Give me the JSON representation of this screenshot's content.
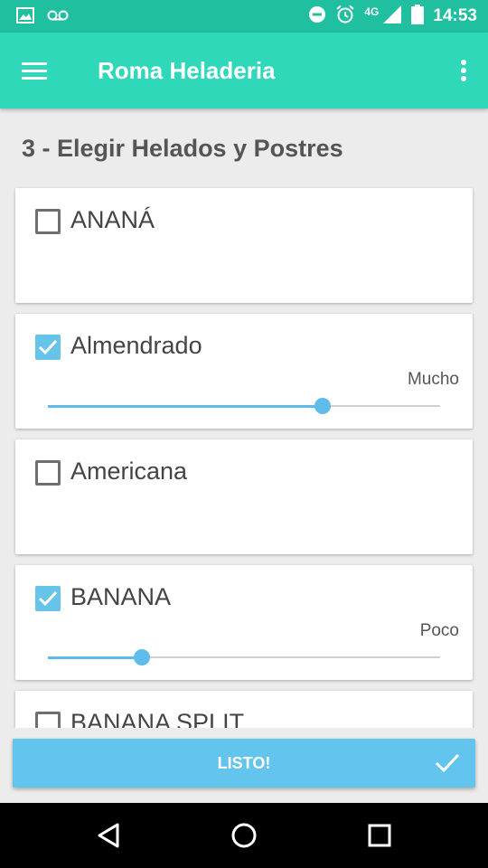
{
  "status_bar": {
    "time": "14:53",
    "network": "4G",
    "icons_left": [
      "image-icon",
      "voicemail-icon"
    ],
    "icons_right": [
      "do-not-disturb-icon",
      "alarm-icon",
      "signal-icon",
      "battery-icon"
    ]
  },
  "app_bar": {
    "title": "Roma Heladeria",
    "menu_icon": "hamburger-menu-icon",
    "overflow_icon": "more-vert-icon"
  },
  "section_title": "3 - Elegir Helados y Postres",
  "items": [
    {
      "name": "ANANÁ",
      "checked": false,
      "quantity_label": "",
      "slider_fraction": null
    },
    {
      "name": "Almendrado",
      "checked": true,
      "quantity_label": "Mucho",
      "slider_fraction": 0.7
    },
    {
      "name": "Americana",
      "checked": false,
      "quantity_label": "",
      "slider_fraction": null
    },
    {
      "name": "BANANA",
      "checked": true,
      "quantity_label": "Poco",
      "slider_fraction": 0.24
    },
    {
      "name": "BANANA SPLIT",
      "checked": false,
      "quantity_label": "",
      "slider_fraction": null
    }
  ],
  "done_button": {
    "label": "LISTO!",
    "icon": "check-icon"
  },
  "nav_bar": {
    "icons": [
      "back-icon",
      "home-icon",
      "recents-icon"
    ]
  },
  "colors": {
    "status_bar": "#1fbf9f",
    "app_bar": "#2ed8b9",
    "accent": "#5fbcea",
    "done_button": "#63c4ee"
  }
}
